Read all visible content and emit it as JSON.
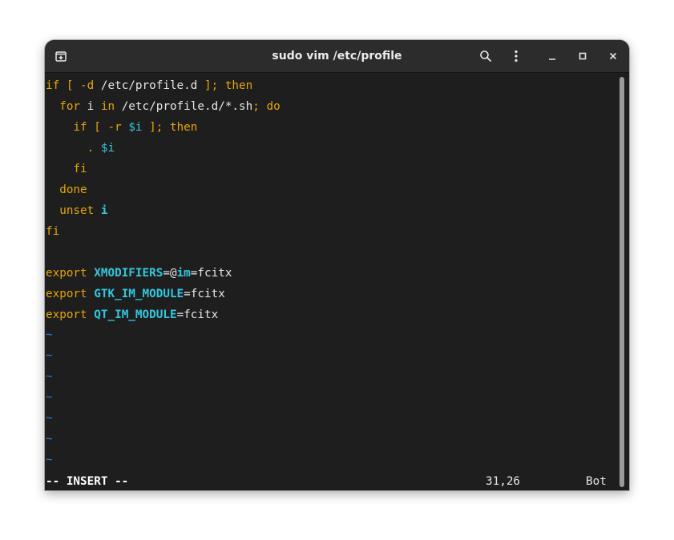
{
  "window": {
    "title": "sudo vim /etc/profile"
  },
  "icons": {
    "new_tab": "new-tab-icon",
    "search": "search-icon",
    "menu": "menu-icon",
    "minimize": "minimize-icon",
    "maximize": "maximize-icon",
    "close": "close-icon"
  },
  "editor": {
    "lines": [
      [
        "if",
        " [ ",
        "-d",
        " /etc/profile.d",
        " ]; ",
        "then"
      ],
      [
        "  ",
        "for",
        " i ",
        "in",
        " /etc/profile.d/*.sh",
        "; ",
        "do"
      ],
      [
        "    ",
        "if",
        " [ ",
        "-r",
        " ",
        "$i",
        " ]; ",
        "then"
      ],
      [
        "      ",
        ". ",
        "$i"
      ],
      [
        "    ",
        "fi"
      ],
      [
        "  ",
        "done"
      ],
      [
        "  ",
        "unset",
        " ",
        "i"
      ],
      [
        "fi"
      ],
      [
        ""
      ],
      [
        "export",
        " ",
        "XMODIFIERS",
        "=@",
        "im",
        "=fcitx"
      ],
      [
        "export",
        " ",
        "GTK_IM_MODULE",
        "=fcitx"
      ],
      [
        "export",
        " ",
        "QT_IM_MODULE",
        "=fcitx"
      ]
    ],
    "tilde": "~",
    "tilde_count": 7,
    "mode": "-- INSERT --",
    "cursor_position": "31,26",
    "scroll_position": "Bot"
  },
  "colors": {
    "keyword": "#e5a50a",
    "identifier": "#33c7de",
    "text": "#e6e6e6",
    "tilde": "#2a7bde",
    "background": "#1e1e1e",
    "titlebar": "#2c2c2c"
  }
}
